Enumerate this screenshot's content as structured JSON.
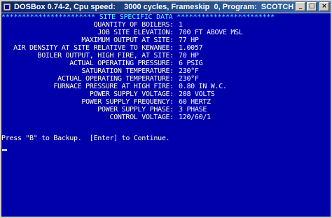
{
  "window": {
    "title": "DOSBox 0.74-2, Cpu speed:    3000 cycles, Frameskip  0, Program:  SCOTCH",
    "icon": "dosbox-icon",
    "buttons": [
      "minimize",
      "maximize",
      "close"
    ]
  },
  "screen": {
    "header": "*********************** SITE SPECIFIC DATA ************************",
    "rows": [
      {
        "label": "QUANTITY OF BOILERS:",
        "value": "1"
      },
      {
        "label": "JOB SITE ELEVATION:",
        "value": "700 FT ABOVE MSL"
      },
      {
        "label": "MAXIMUM OUTPUT AT SITE:",
        "value": "77 HP"
      },
      {
        "label": "AIR DENSITY AT SITE RELATIVE TO KEWANEE:",
        "value": "1.0057"
      },
      {
        "label": "BOILER OUTPUT, HIGH FIRE, AT SITE:",
        "value": "70 HP"
      },
      {
        "label": "ACTUAL OPERATING PRESSURE:",
        "value": "6 PSIG"
      },
      {
        "label": "SATURATION TEMPERATURE:",
        "value": "230°F"
      },
      {
        "label": "ACTUAL OPERATING TEMPERATURE:",
        "value": "230°F"
      },
      {
        "label": "FURNACE PRESSURE AT HIGH FIRE:",
        "value": "0.80 IN W.C."
      },
      {
        "label": "POWER SUPPLY VOLTAGE:",
        "value": "208 VOLTS"
      },
      {
        "label": "POWER SUPPLY FREQUENCY:",
        "value": "60 HERTZ"
      },
      {
        "label": "POWER SUPPLY PHASE:",
        "value": "3 PHASE"
      },
      {
        "label": "CONTROL VOLTAGE:",
        "value": "120/60/1"
      }
    ],
    "prompt": "Press \"B\" to Backup.  [Enter] to Continue.",
    "colors": {
      "background": "#0000aa",
      "header": "#55ffff",
      "text": "#ffffff"
    }
  }
}
